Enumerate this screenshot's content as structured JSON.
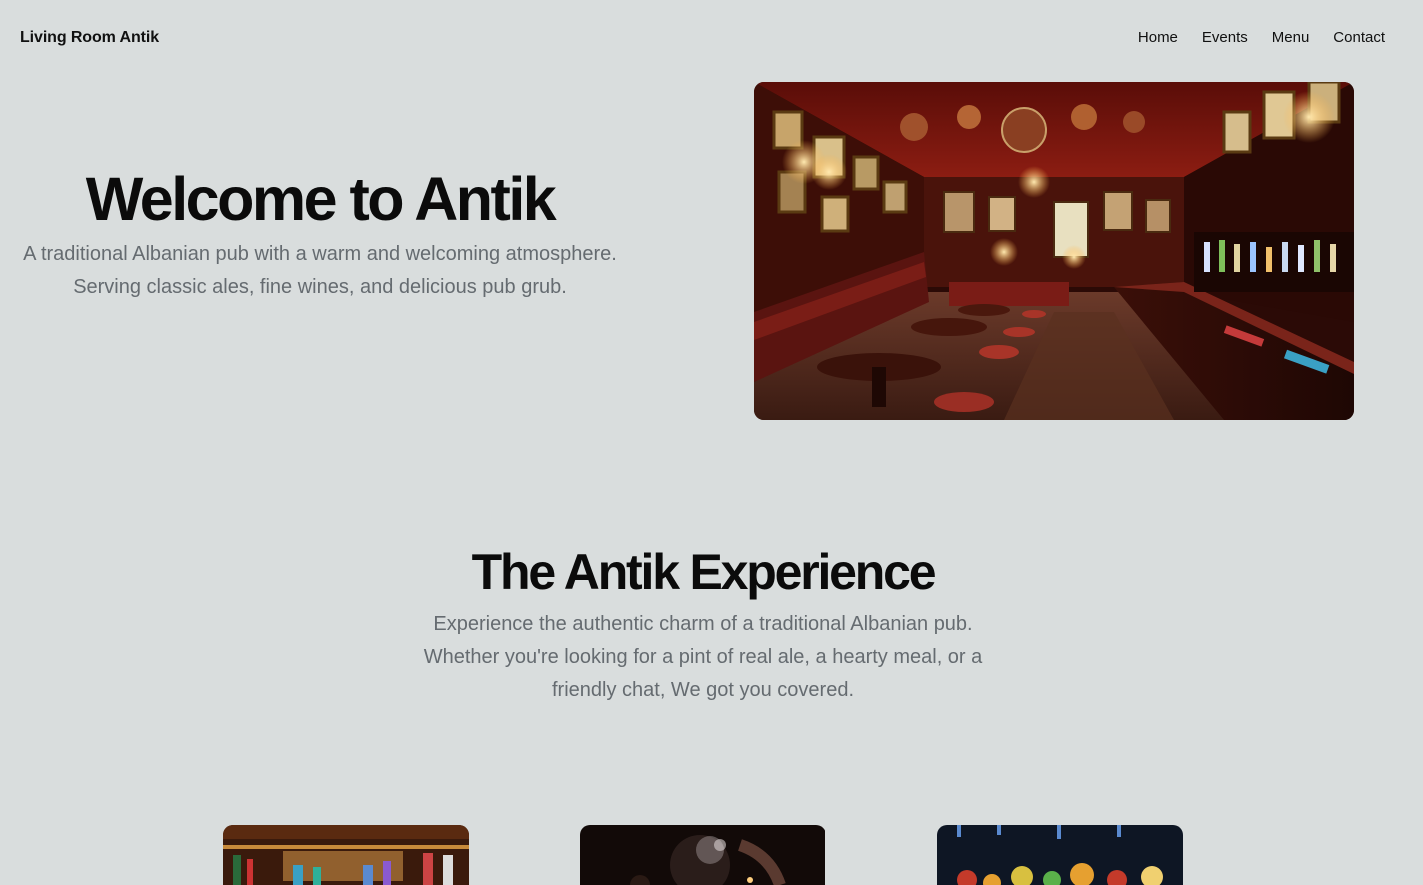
{
  "header": {
    "brand": "Living Room Antik",
    "nav": {
      "home": "Home",
      "events": "Events",
      "menu": "Menu",
      "contact": "Contact"
    }
  },
  "hero": {
    "title": "Welcome to Antik",
    "subtitle": "A traditional Albanian pub with a warm and welcoming atmosphere. Serving classic ales, fine wines, and delicious pub grub."
  },
  "experience": {
    "title": "The Antik Experience",
    "subtitle": "Experience the authentic charm of a traditional Albanian pub. Whether you're looking for a pint of real ale, a hearty meal, or a friendly chat, We got you covered."
  },
  "colors": {
    "background": "#d9dddd",
    "heading": "#0b0b0b",
    "body_text": "#656b70"
  }
}
